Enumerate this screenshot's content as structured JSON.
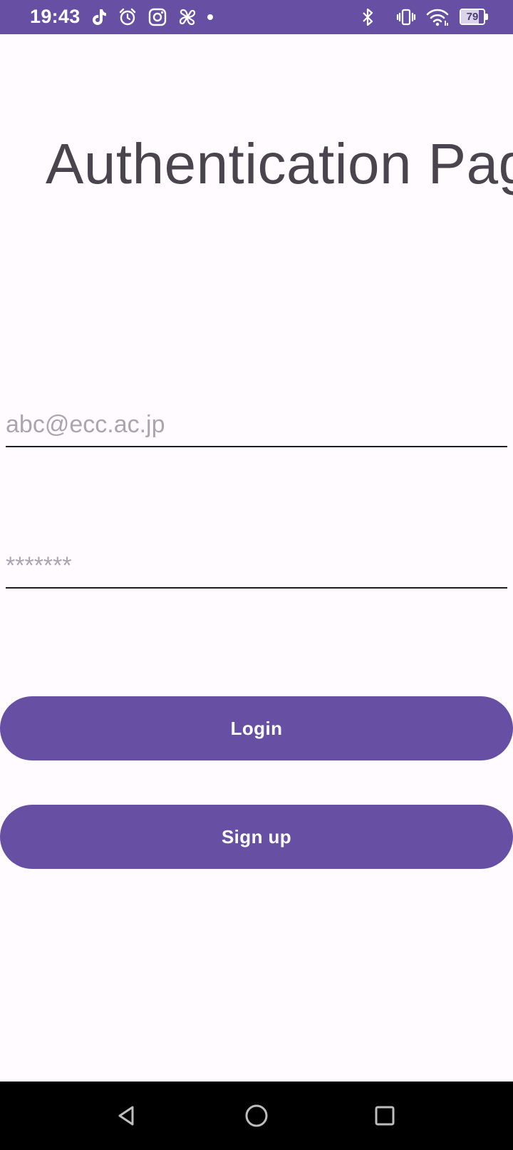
{
  "status_bar": {
    "time": "19:43",
    "icons": [
      "tiktok-icon",
      "alarm-icon",
      "instagram-icon",
      "pinwheel-icon",
      "notification-dot",
      "bluetooth-icon",
      "vibrate-icon",
      "wifi-icon"
    ],
    "battery_level": "79",
    "background_color": "#6750a4"
  },
  "page": {
    "title": "Authentication Page"
  },
  "form": {
    "email_placeholder": "abc@ecc.ac.jp",
    "email_value": "",
    "password_placeholder": "*******",
    "password_value": ""
  },
  "buttons": {
    "login_label": "Login",
    "signup_label": "Sign up",
    "color": "#6750a4"
  },
  "nav_bar": {
    "icons": [
      "back-icon",
      "home-icon",
      "recents-icon"
    ]
  }
}
